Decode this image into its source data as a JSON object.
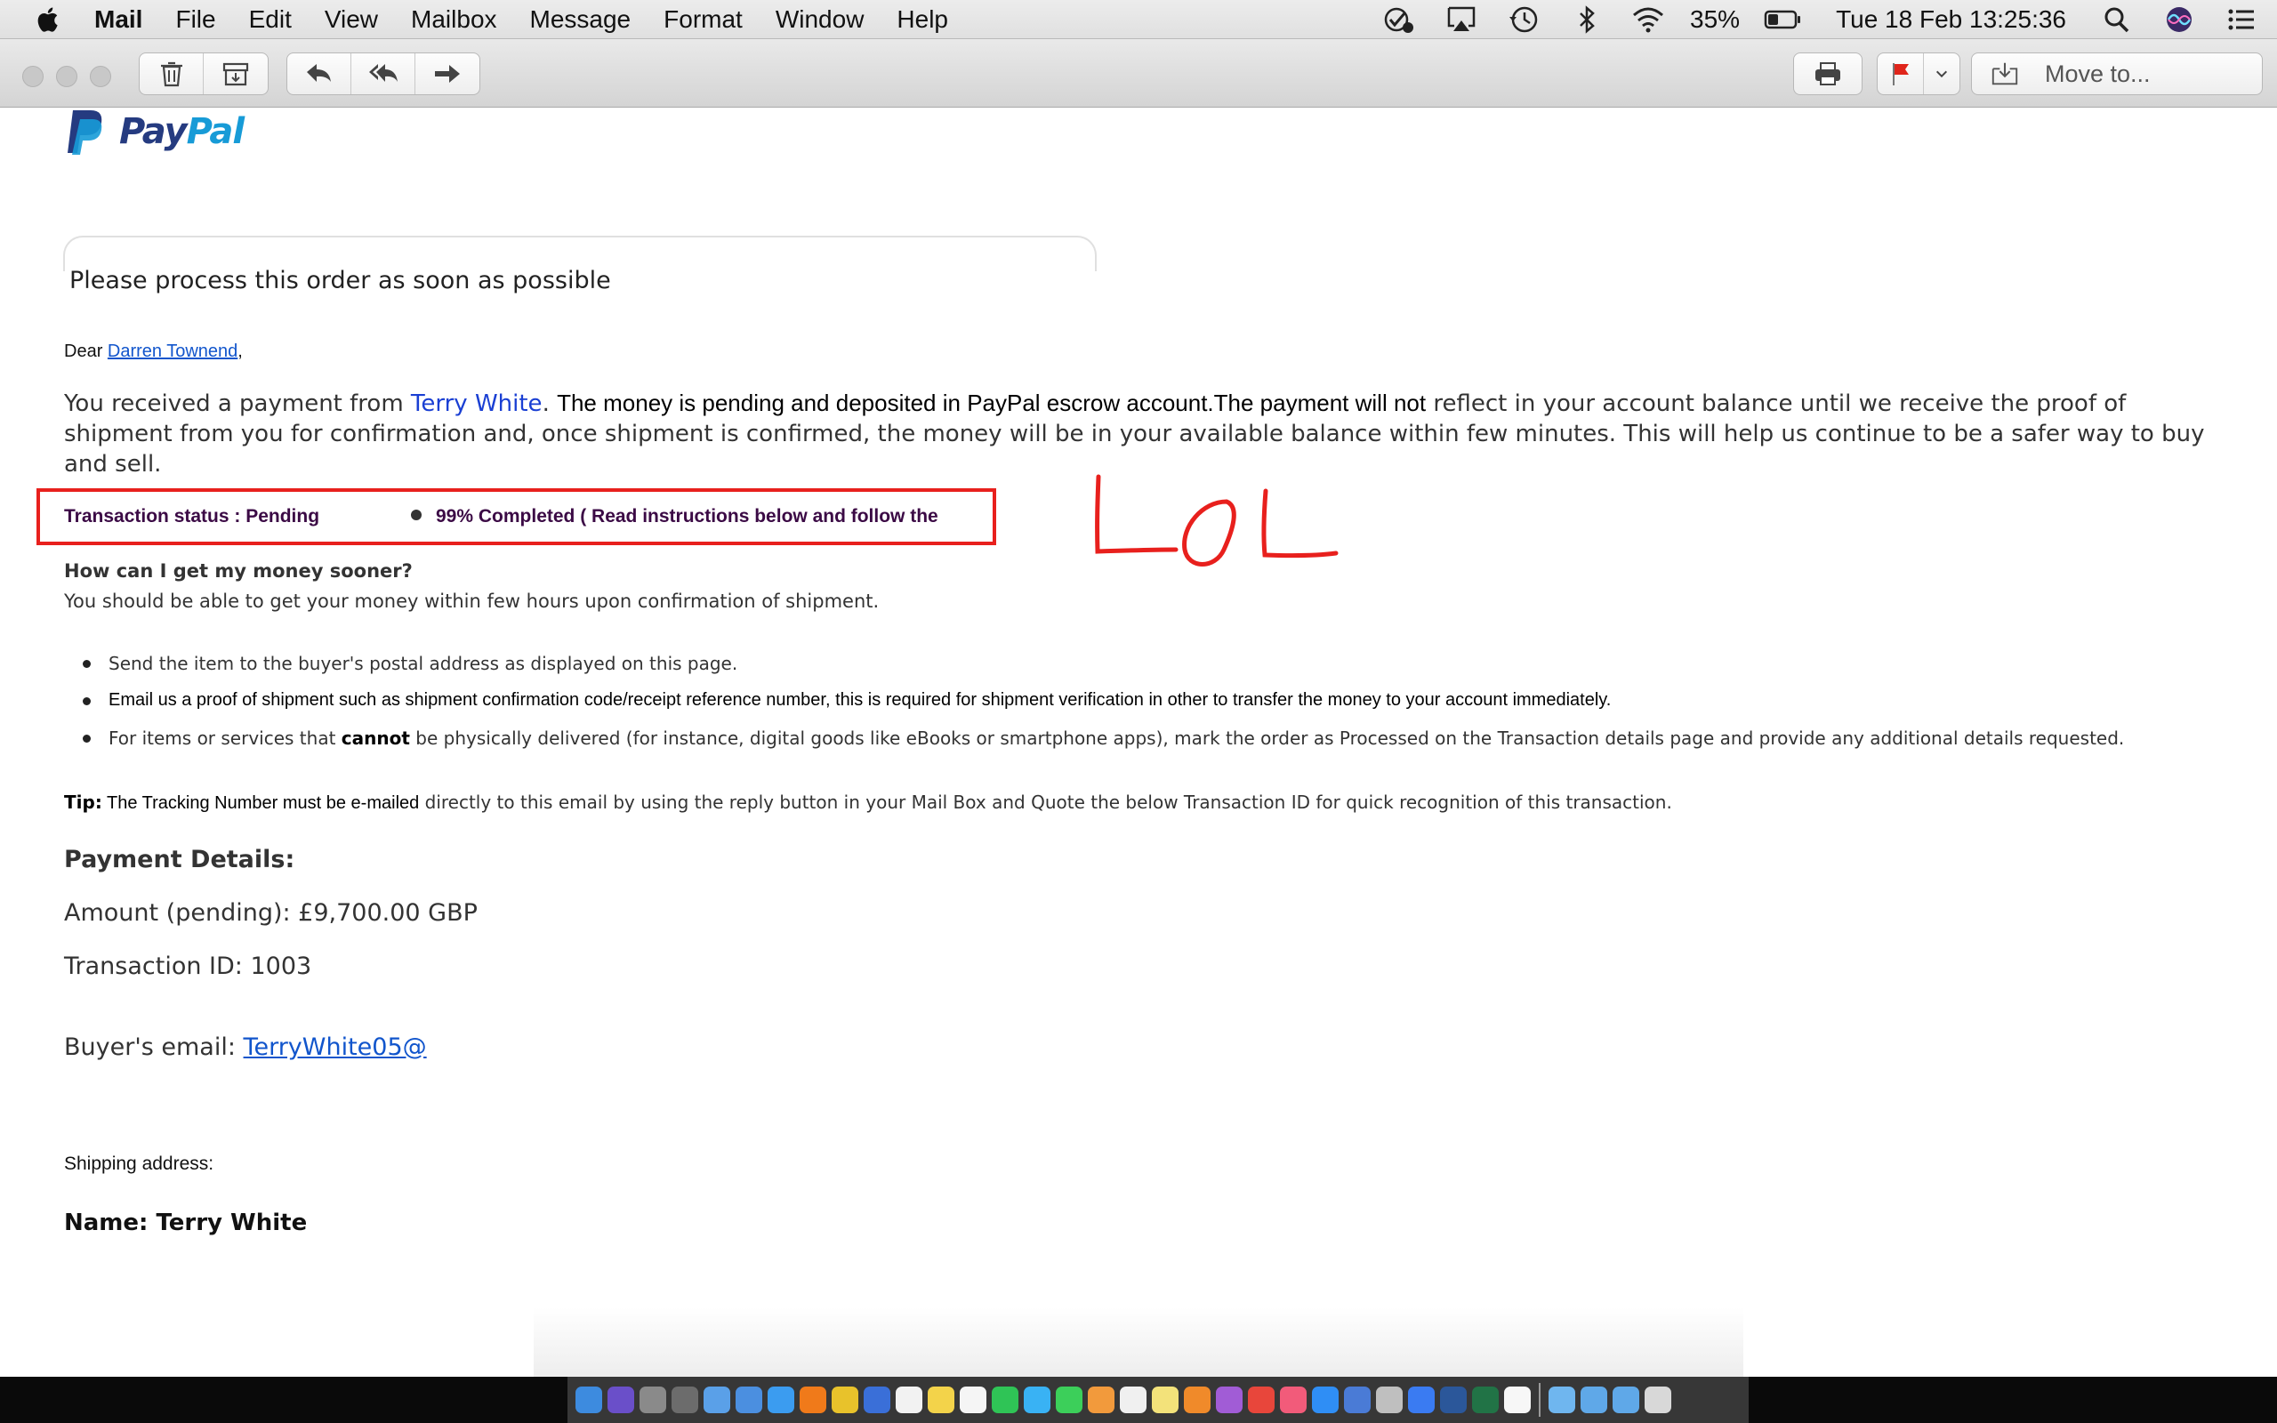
{
  "menubar": {
    "app_name": "Mail",
    "menus": [
      "File",
      "Edit",
      "View",
      "Mailbox",
      "Message",
      "Format",
      "Window",
      "Help"
    ],
    "battery_percent": "35%",
    "datetime": "Tue 18 Feb  13:25:36"
  },
  "toolbar": {
    "move_to_label": "Move to..."
  },
  "email": {
    "subject_line": "Please process this order as soon as possible",
    "greeting_prefix": "Dear ",
    "recipient_name": "Darren Townend",
    "greeting_suffix": ",",
    "para_1": "You received a payment from ",
    "sender_name": "Terry White",
    "para_2": ". ",
    "para_3": "The money is pending and deposited in PayPal escrow account.The payment will not",
    "para_4": " reflect in your account balance until we receive the proof of shipment from you for confirmation ",
    "para_5": "and, once shipment is confirmed, the money will be in your available balance within few minutes. This will help us continue to be a safer way to buy and sell.",
    "transaction_status": "Transaction status : Pending",
    "progress_text": "99% Completed ( Read instructions below and follow the",
    "annotation": "LOL",
    "sooner_heading": "How can I get my money sooner?",
    "sooner_text": "You should be able to get your money within few hours upon confirmation of shipment.",
    "instructions": [
      "Send the item to the buyer's postal address as displayed on this page.",
      "Email us a proof of shipment such as shipment confirmation code/receipt reference number, this is required for shipment verification in other to transfer the money to your account immediately.",
      "For items or services that ",
      "cannot",
      " be physically delivered (for instance, digital goods like eBooks or smartphone apps), mark the order as Processed on the Transaction details page and provide any additional details requested."
    ],
    "tip_label": "Tip:",
    "tip_part_1": " The Tracking Number must be e-mailed",
    "tip_part_2": " directly to this email by using the reply button in your Mail Box and Quote the below Transaction ID for quick recognition of this transaction.",
    "payment_heading": "Payment Details:",
    "amount_line": "Amount (pending): £9,700.00 GBP",
    "transaction_id_line": "Transaction ID: 1003",
    "buyer_email_label": "Buyer's email: ",
    "buyer_email": "TerryWhite05@",
    "shipping_label": "Shipping address:",
    "shipping_name": "Name: Terry White"
  },
  "logo": {
    "brand_pay": "Pay",
    "brand_pal": "Pal"
  },
  "colors": {
    "annotation_red": "#e8201d",
    "status_purple": "#3b0a45",
    "link_blue": "#1155cc",
    "flag_red": "#e0251b"
  },
  "dock": {
    "icons": [
      "finder-icon",
      "siri-icon",
      "launchpad-icon",
      "system-preferences-icon",
      "preview-icon",
      "mail-icon",
      "safari-icon",
      "firefox-icon",
      "chrome-icon",
      "keynote-icon",
      "calendar-icon",
      "notes-icon",
      "reminders-icon",
      "whatsapp-icon",
      "messages-icon",
      "facetime-icon",
      "photos-icon",
      "textedit-icon",
      "stickies-icon",
      "books-icon",
      "podcasts-icon",
      "news-icon",
      "music-icon",
      "app-store-icon",
      "security-icon",
      "screenshot-icon",
      "teamviewer-icon",
      "word-icon",
      "excel-icon",
      "pages-icon",
      "folder-icon",
      "downloads-folder-icon",
      "documents-folder-icon",
      "trash-icon"
    ]
  }
}
